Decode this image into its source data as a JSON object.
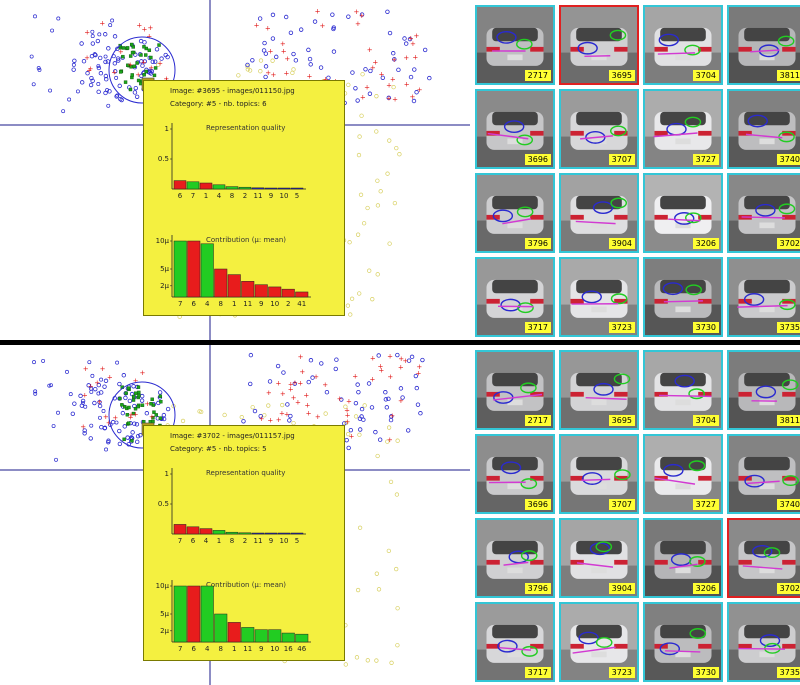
{
  "views": [
    {
      "image_info": "Image: #3695 - images/011150.jpg",
      "category_info": "Category: #5 - nb. topics: 6",
      "quality_chart": {
        "title": "Representation quality",
        "y_ticks": [
          "1",
          "0.5"
        ],
        "categories": [
          "6",
          "7",
          "1",
          "4",
          "8",
          "2",
          "11",
          "9",
          "10",
          "5"
        ],
        "values": [
          0.14,
          0.12,
          0.1,
          0.07,
          0.04,
          0.03,
          0.02,
          0.015,
          0.01,
          0.008
        ],
        "colors": [
          "#e81c1c",
          "#22cc22",
          "#e81c1c",
          "#22cc22",
          "#22cc22",
          "#22cc22",
          "#2222cc",
          "#2222cc",
          "#2222cc",
          "#2222cc"
        ]
      },
      "contribution_chart": {
        "title": "Contribution (µ: mean)",
        "y_ticks": [
          "10µ",
          "5µ",
          "2µ"
        ],
        "categories": [
          "7",
          "6",
          "4",
          "8",
          "1",
          "11",
          "9",
          "10",
          "2",
          "41"
        ],
        "values": [
          10,
          10,
          9.5,
          5,
          4,
          2.8,
          2.2,
          1.8,
          1.4,
          0.9
        ],
        "colors": [
          "#22cc22",
          "#e81c1c",
          "#22cc22",
          "#e81c1c",
          "#e81c1c",
          "#e81c1c",
          "#e81c1c",
          "#e81c1c",
          "#e81c1c",
          "#e81c1c"
        ]
      },
      "selected_tile": 1
    },
    {
      "image_info": "Image: #3702 - images/011157.jpg",
      "category_info": "Category: #5 - nb. topics: 5",
      "quality_chart": {
        "title": "Representation quality",
        "y_ticks": [
          "1",
          "0.5"
        ],
        "categories": [
          "7",
          "6",
          "4",
          "1",
          "8",
          "2",
          "11",
          "9",
          "10",
          "5"
        ],
        "values": [
          0.16,
          0.12,
          0.09,
          0.06,
          0.03,
          0.02,
          0.015,
          0.01,
          0.008,
          0.006
        ],
        "colors": [
          "#e81c1c",
          "#e81c1c",
          "#e81c1c",
          "#22cc22",
          "#22cc22",
          "#22cc22",
          "#2222cc",
          "#2222cc",
          "#2222cc",
          "#2222cc"
        ]
      },
      "contribution_chart": {
        "title": "Contribution (µ: mean)",
        "y_ticks": [
          "10µ",
          "5µ",
          "2µ"
        ],
        "categories": [
          "7",
          "6",
          "4",
          "8",
          "1",
          "11",
          "9",
          "10",
          "16",
          "46"
        ],
        "values": [
          10,
          10,
          10,
          5,
          3.5,
          2.6,
          2.2,
          2.2,
          1.6,
          1.4
        ],
        "colors": [
          "#22cc22",
          "#e81c1c",
          "#22cc22",
          "#22cc22",
          "#e81c1c",
          "#22cc22",
          "#22cc22",
          "#22cc22",
          "#22cc22",
          "#22cc22"
        ]
      },
      "selected_tile": 11
    }
  ],
  "tiles": [
    "2717",
    "3695",
    "3704",
    "3811",
    "3696",
    "3707",
    "3727",
    "3740",
    "3796",
    "3904",
    "3206",
    "3702",
    "3717",
    "3723",
    "3730",
    "3735"
  ],
  "colors": {
    "popup_bg": "#f4f040",
    "tile_border": "#33c6d6",
    "selected_border": "#e02020",
    "axis": "#1a1a8a"
  }
}
